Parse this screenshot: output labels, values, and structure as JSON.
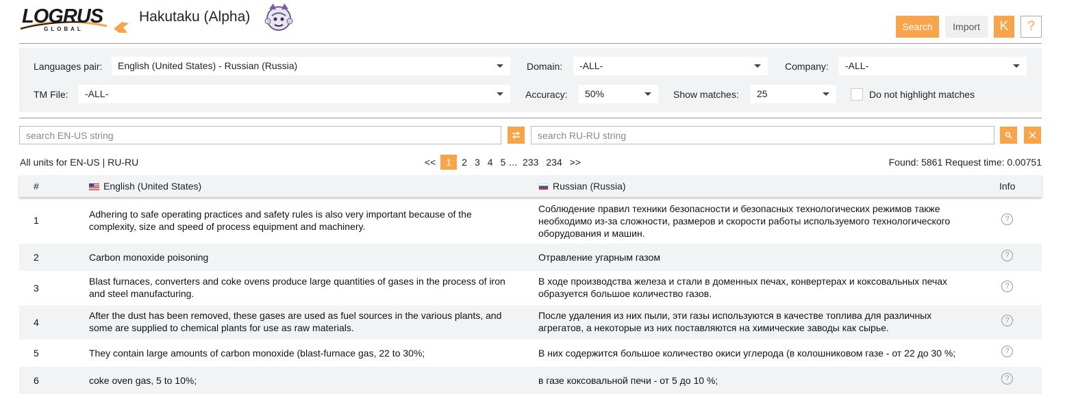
{
  "header": {
    "logo_text": "LOGRUS",
    "logo_sub": "GLOBAL",
    "title": "Hakutaku (Alpha)",
    "search_label": "Search",
    "import_label": "Import",
    "user_initial": "K",
    "help_label": "?"
  },
  "filters": {
    "lang_pair_label": "Languages pair:",
    "lang_pair_value": "English (United States) - Russian (Russia)",
    "domain_label": "Domain:",
    "domain_value": "-ALL-",
    "company_label": "Company:",
    "company_value": "-ALL-",
    "tm_file_label": "TM File:",
    "tm_file_value": "-ALL-",
    "accuracy_label": "Accuracy:",
    "accuracy_value": "50%",
    "show_matches_label": "Show matches:",
    "show_matches_value": "25",
    "no_highlight_label": "Do not highlight matches",
    "no_highlight_checked": false
  },
  "search": {
    "source_placeholder": "search EN-US string",
    "target_placeholder": "search RU-RU string"
  },
  "pager": {
    "units_label": "All units for EN-US | RU-RU",
    "first": "<<",
    "pages": [
      "1",
      "2",
      "3",
      "4",
      "5"
    ],
    "ellipsis": "...",
    "last_pages": [
      "233",
      "234"
    ],
    "next": ">>",
    "found_text": "Found: 5861 Request time: 0.00751"
  },
  "table": {
    "col_num": "#",
    "col_source": "English (United States)",
    "col_target": "Russian (Russia)",
    "col_info": "Info",
    "rows": [
      {
        "num": "1",
        "en": "Adhering to safe operating practices and safety rules is also very important because of the complexity, size and speed of process equipment and machinery.",
        "ru": "Соблюдение правил техники безопасности и безопасных технологических режимов также необходимо из-за сложности, размеров и скорости работы используемого технологического оборудования и машин."
      },
      {
        "num": "2",
        "en": "Carbon monoxide poisoning",
        "ru": "Отравление угарным газом"
      },
      {
        "num": "3",
        "en": "Blast furnaces, converters and coke ovens produce large quantities of gases in the process of iron and steel manufacturing.",
        "ru": "В ходе производства железа и стали в доменных печах, конвертерах и коксовальных печах образуется большое количество газов."
      },
      {
        "num": "4",
        "en": "After the dust has been removed, these gases are used as fuel sources in the various plants, and some are supplied to chemical plants for use as raw materials.",
        "ru": "После удаления из них пыли, эти газы используются в качестве топлива для различных агрегатов, а некоторые из них поставляются на химические заводы как сырье."
      },
      {
        "num": "5",
        "en": "They contain large amounts of carbon monoxide (blast-furnace gas, 22 to 30%;",
        "ru": "В них содержится большое количество окиси углерода (в колошниковом газе - от 22 до 30 %;"
      },
      {
        "num": "6",
        "en": "coke oven gas, 5 to 10%;",
        "ru": "в газе коксовальной печи - от 5 до 10 %;"
      }
    ],
    "info_icon_text": "?"
  },
  "colors": {
    "accent": "#f7a44a",
    "panel_bg": "#f2f3f5"
  }
}
